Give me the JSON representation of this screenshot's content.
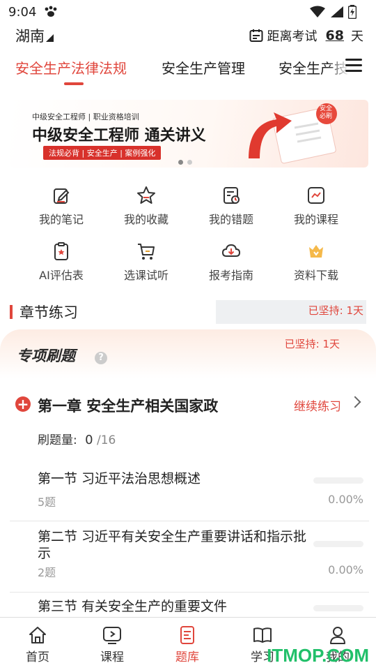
{
  "status": {
    "time": "9:04"
  },
  "header": {
    "region": "湖南",
    "exam_label": "距离考试",
    "exam_days": "68",
    "exam_unit": "天"
  },
  "tabs": [
    {
      "label": "安全生产法律法规",
      "active": true
    },
    {
      "label": "安全生产管理",
      "active": false
    },
    {
      "label": "安全生产技",
      "active": false
    }
  ],
  "banner": {
    "small_text": "中级安全工程师 | 职业资格培训",
    "title": "中级安全工程师 通关讲义",
    "tags": "法规必背 | 安全生产 | 案例强化",
    "seal": "安全必刷"
  },
  "shortcuts": [
    {
      "label": "我的笔记",
      "icon": "note-edit-icon"
    },
    {
      "label": "我的收藏",
      "icon": "star-icon"
    },
    {
      "label": "我的错题",
      "icon": "error-book-icon"
    },
    {
      "label": "我的课程",
      "icon": "course-chart-icon"
    },
    {
      "label": "AI评估表",
      "icon": "clipboard-star-icon"
    },
    {
      "label": "选课试听",
      "icon": "cart-icon"
    },
    {
      "label": "报考指南",
      "icon": "cloud-download-icon"
    },
    {
      "label": "资料下载",
      "icon": "crown-gift-icon"
    }
  ],
  "practice": {
    "section_title": "章节练习",
    "streak_top": "已坚持: 1天",
    "special_title": "专项刷题",
    "special_streak": "已坚持: 1天"
  },
  "chapter": {
    "title": "第一章 安全生产相关国家政",
    "continue_label": "继续练习",
    "count_label": "刷题量:",
    "done": "0",
    "total": "/16"
  },
  "sections": [
    {
      "title": "第一节 习近平法治思想概述",
      "count": "5题",
      "percent": "0.00%",
      "progress": 0
    },
    {
      "title": "第二节 习近平有关安全生产重要讲话和指示批示",
      "count": "2题",
      "percent": "0.00%",
      "progress": 0
    },
    {
      "title": "第三节 有关安全生产的重要文件",
      "count": "",
      "percent": "",
      "progress": 0
    }
  ],
  "bottom_nav": [
    {
      "label": "首页",
      "icon": "home-icon",
      "active": false
    },
    {
      "label": "课程",
      "icon": "play-screen-icon",
      "active": false
    },
    {
      "label": "题库",
      "icon": "question-bank-icon",
      "active": true
    },
    {
      "label": "学习",
      "icon": "open-book-icon",
      "active": false
    },
    {
      "label": "我的",
      "icon": "person-icon",
      "active": false
    }
  ],
  "watermark": "ITMOP.COM",
  "colors": {
    "accent": "#e0463c",
    "text": "#222222",
    "muted": "#999999"
  }
}
